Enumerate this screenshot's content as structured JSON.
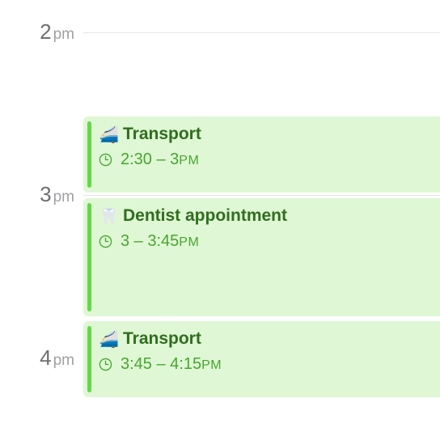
{
  "hours": [
    {
      "num": "2",
      "suffix": "pm"
    },
    {
      "num": "3",
      "suffix": "pm"
    },
    {
      "num": "4",
      "suffix": "pm"
    }
  ],
  "events": [
    {
      "emoji": "🚄",
      "icon": "train-icon",
      "title": "Transport",
      "time": "2:30 – 3",
      "ampm": "PM"
    },
    {
      "emoji": "🦷",
      "icon": "tooth-icon",
      "title": "Dentist appointment",
      "time": "3 – 3:45",
      "ampm": "PM"
    },
    {
      "emoji": "🚄",
      "icon": "train-icon",
      "title": "Transport",
      "time": "3:45 – 4:15",
      "ampm": "PM"
    }
  ],
  "colors": {
    "event_bg": "#dff7d4",
    "event_bar": "#63d94a",
    "event_title": "#2f6e1f",
    "event_time": "#47a631"
  }
}
